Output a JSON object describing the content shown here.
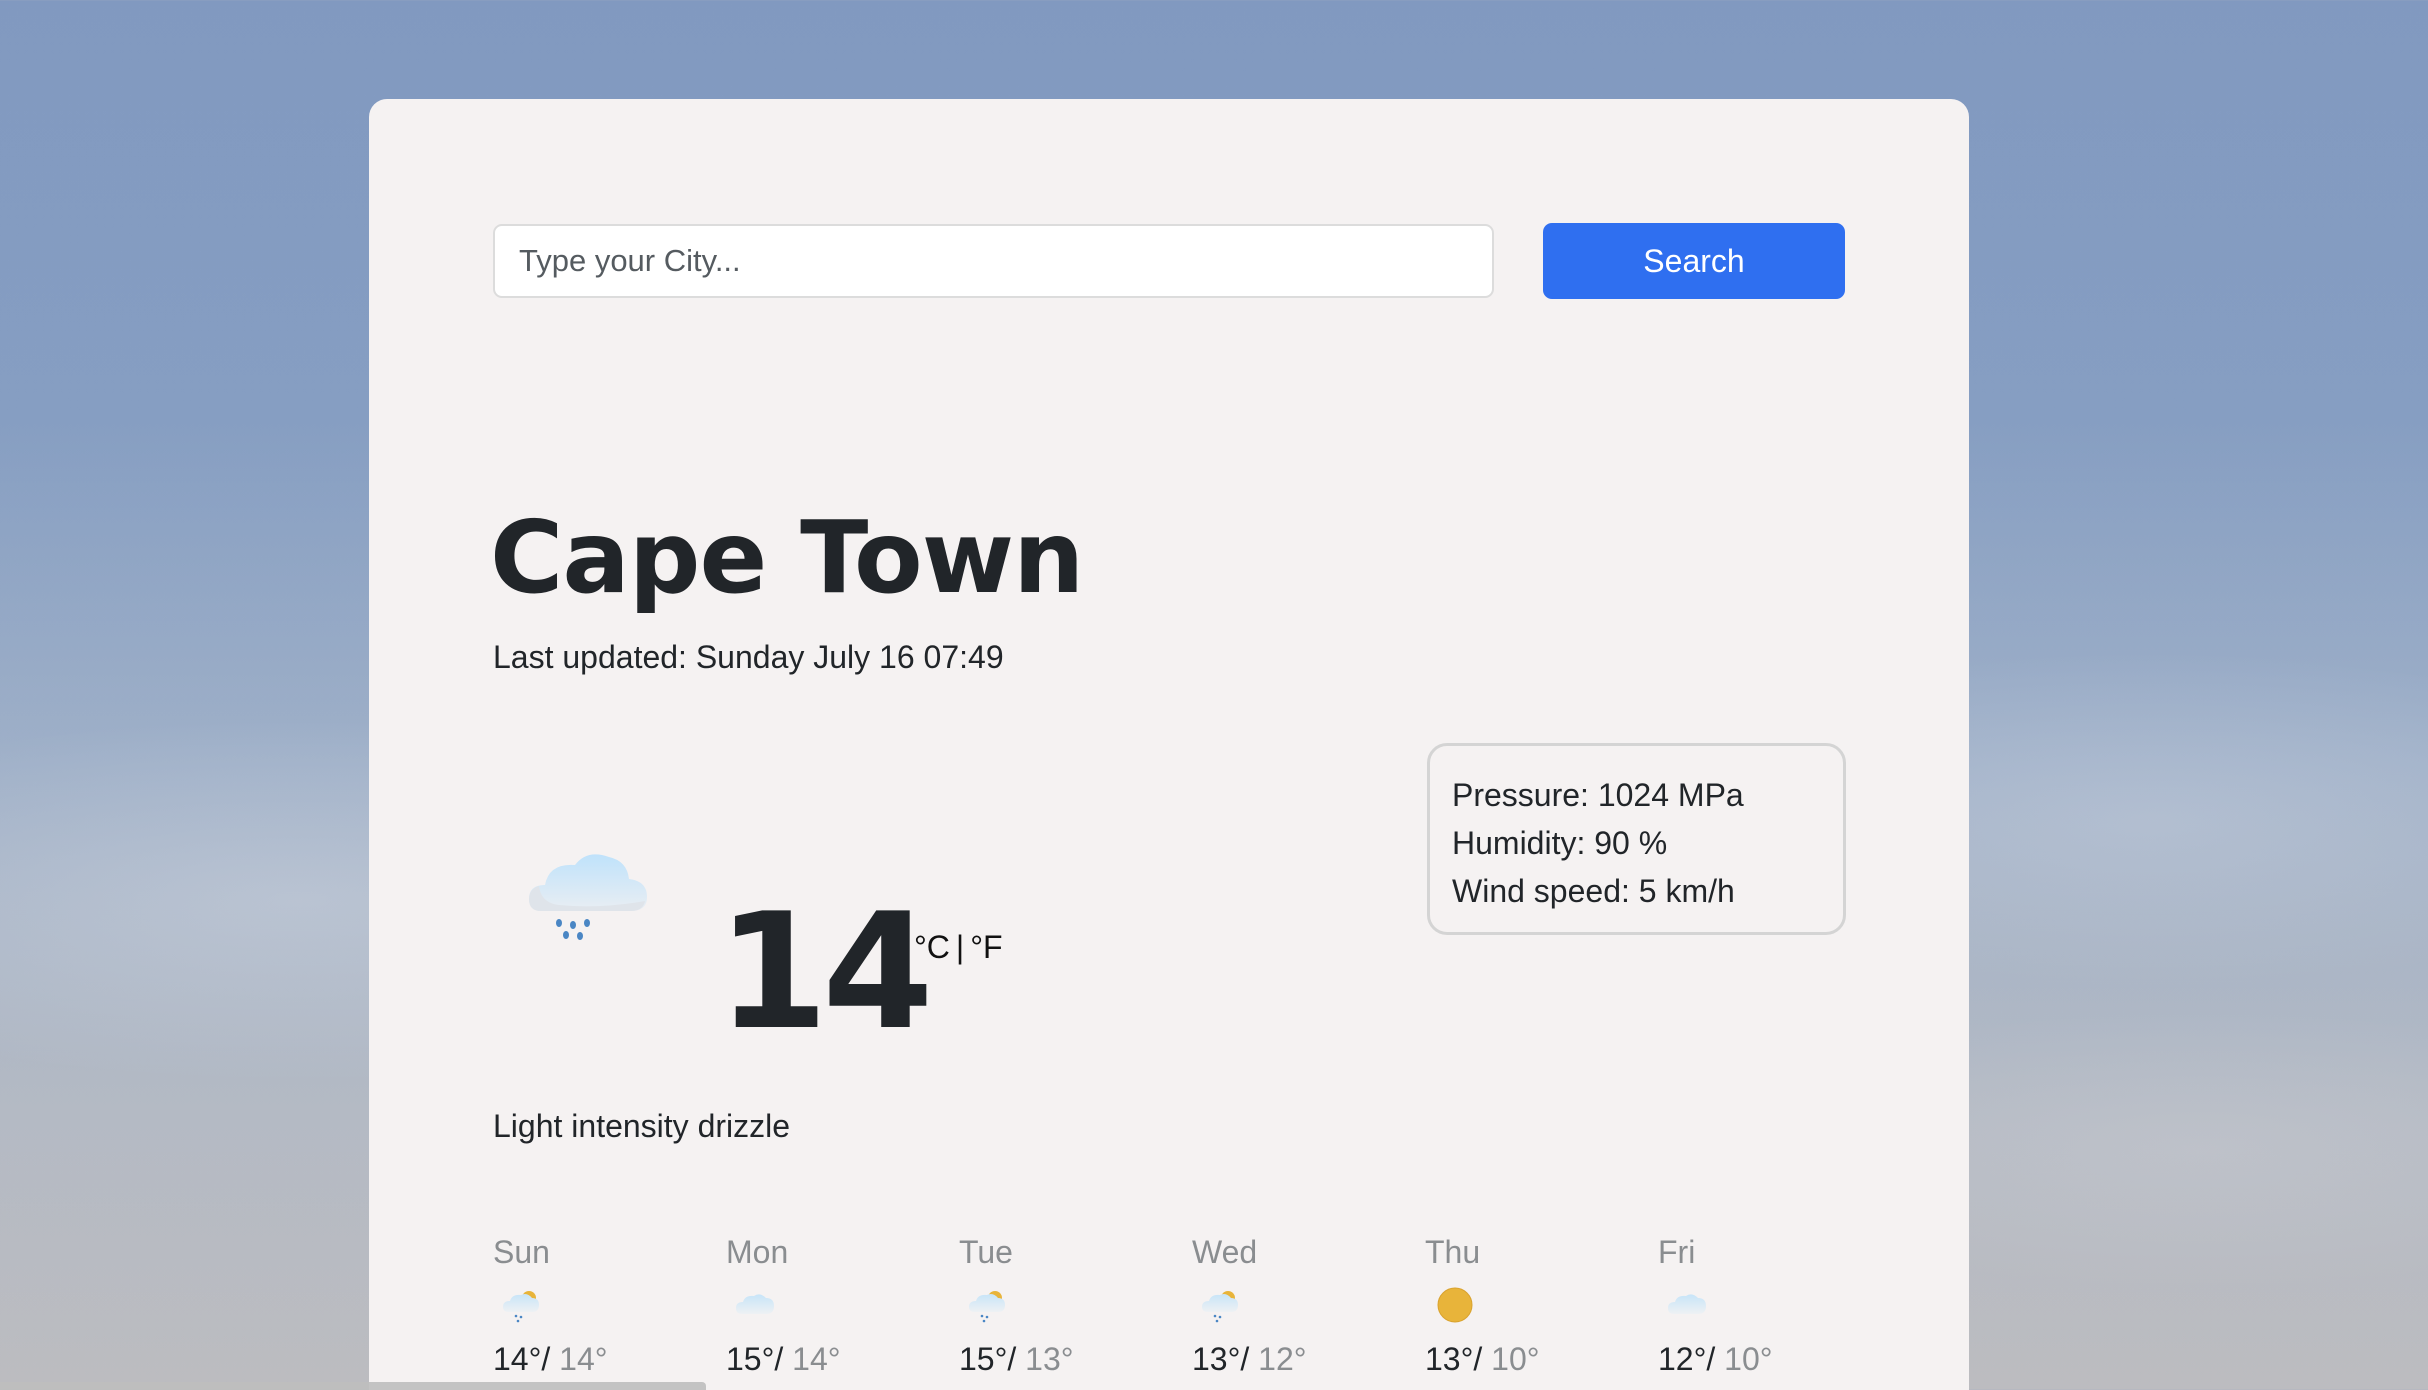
{
  "search": {
    "placeholder": "Type your City...",
    "value": "",
    "button_label": "Search"
  },
  "current": {
    "city": "Cape Town",
    "last_updated": "Last updated: Sunday July 16 07:49",
    "icon": "rain-cloud-icon",
    "temperature": "14",
    "unit_celsius": "°C",
    "unit_separator": "|",
    "unit_fahrenheit": "°F",
    "description": "Light intensity drizzle",
    "pressure": "Pressure: 1024 MPa",
    "humidity": "Humidity: 90 %",
    "wind": "Wind speed: 5 km/h"
  },
  "forecast": [
    {
      "day": "Sun",
      "icon": "sun-rain-cloud-icon",
      "max": "14°/",
      "min": "14°"
    },
    {
      "day": "Mon",
      "icon": "cloud-icon",
      "max": "15°/",
      "min": "14°"
    },
    {
      "day": "Tue",
      "icon": "sun-rain-cloud-icon",
      "max": "15°/",
      "min": "13°"
    },
    {
      "day": "Wed",
      "icon": "sun-rain-cloud-icon",
      "max": "13°/",
      "min": "12°"
    },
    {
      "day": "Thu",
      "icon": "sun-icon",
      "max": "13°/",
      "min": "10°"
    },
    {
      "day": "Fri",
      "icon": "cloud-icon",
      "max": "12°/",
      "min": "10°"
    }
  ],
  "colors": {
    "accent": "#2f6ff0",
    "card_background": "#f5f2f2",
    "text": "#212529",
    "muted_text": "#8a8d90",
    "sun": "#e8b43a",
    "rain": "#4a86c4"
  }
}
